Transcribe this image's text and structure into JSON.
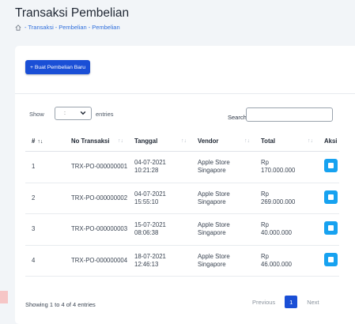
{
  "header": {
    "title": "Transaksi Pembelian",
    "breadcrumb": [
      "Transaksi",
      "Pembelian",
      "Pembelian"
    ],
    "separator": "-"
  },
  "toolbar": {
    "new_button_label": "+ Buat Pembelian Baru"
  },
  "table_controls": {
    "show_label": "Show",
    "entries_value": ":",
    "entries_label": "entries",
    "search_label": "Search:",
    "search_value": ""
  },
  "table": {
    "columns": [
      "#",
      "No Transaksi",
      "Tanggal",
      "Vendor",
      "Total",
      "Aksi"
    ],
    "rows": [
      {
        "no": "1",
        "trx": "TRX-PO-000000001",
        "date": "04-07-2021",
        "time": "10:21:28",
        "vendor1": "Apple Store",
        "vendor2": "Singapore",
        "total1": "Rp",
        "total2": "170.000.000"
      },
      {
        "no": "2",
        "trx": "TRX-PO-000000002",
        "date": "04-07-2021",
        "time": "15:55:10",
        "vendor1": "Apple Store",
        "vendor2": "Singapore",
        "total1": "Rp",
        "total2": "269.000.000"
      },
      {
        "no": "3",
        "trx": "TRX-PO-000000003",
        "date": "15-07-2021",
        "time": "08:06:38",
        "vendor1": "Apple Store",
        "vendor2": "Singapore",
        "total1": "Rp",
        "total2": "40.000.000"
      },
      {
        "no": "4",
        "trx": "TRX-PO-000000004",
        "date": "18-07-2021",
        "time": "12:46:13",
        "vendor1": "Apple Store",
        "vendor2": "Singapore",
        "total1": "Rp",
        "total2": "46.000.000"
      }
    ]
  },
  "footer": {
    "info": "Showing 1 to 4 of 4 entries",
    "prev": "Previous",
    "page": "1",
    "next": "Next"
  },
  "colors": {
    "primary": "#1a4fd6",
    "action": "#17a2f0",
    "link": "#2f6fdc"
  },
  "icons": {
    "breadcrumb_home": "home-icon",
    "select": "chevron-down-icon",
    "action": "square-icon"
  }
}
